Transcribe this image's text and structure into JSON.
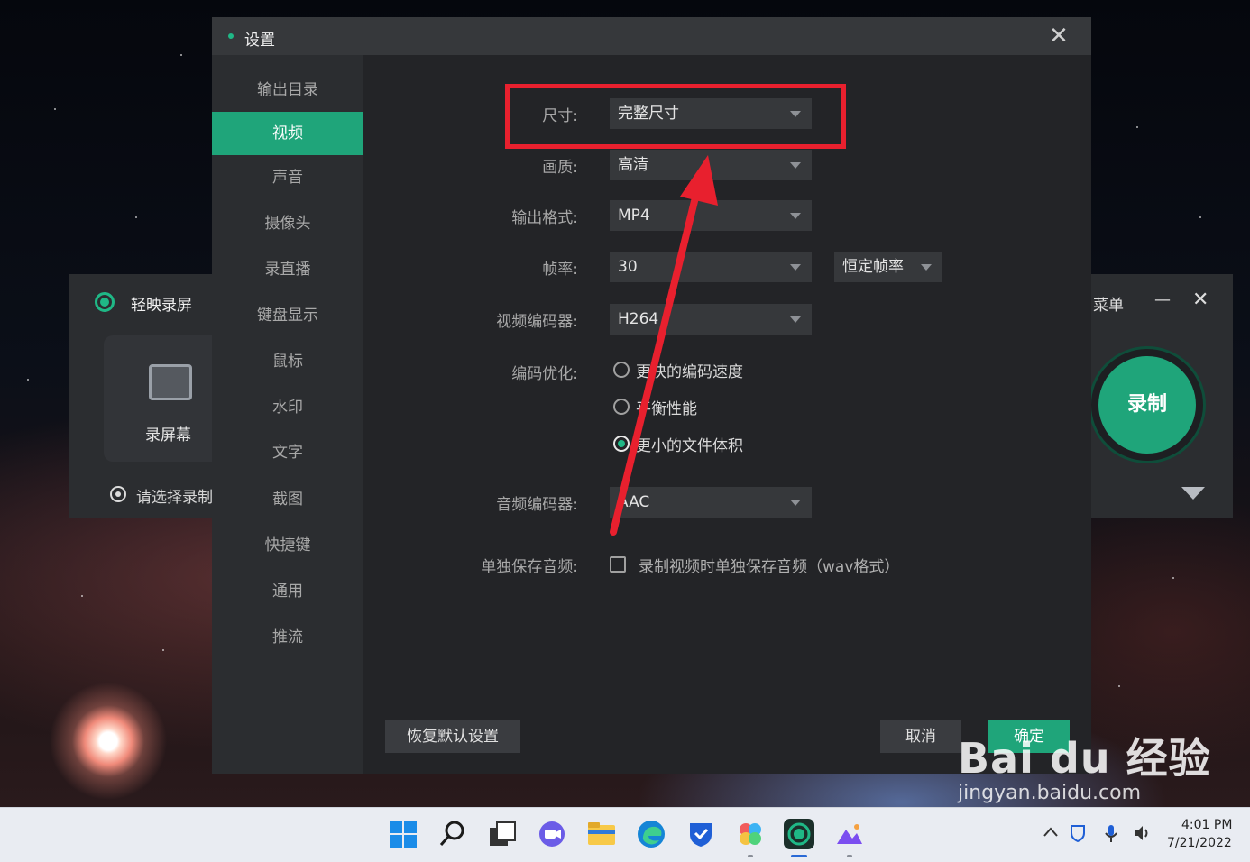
{
  "background_app": {
    "title": "轻映录屏",
    "menu_label": "菜单",
    "min_icon": "—",
    "close_icon": "✕",
    "record_screen_label": "录屏幕",
    "region_placeholder": "请选择录制",
    "record_button_label": "录制"
  },
  "dialog": {
    "title": "设置",
    "close_icon": "✕",
    "sidebar": [
      {
        "label": "输出目录",
        "active": false
      },
      {
        "label": "视频",
        "active": true
      },
      {
        "label": "声音",
        "active": false
      },
      {
        "label": "摄像头",
        "active": false
      },
      {
        "label": "录直播",
        "active": false
      },
      {
        "label": "键盘显示",
        "active": false
      },
      {
        "label": "鼠标",
        "active": false
      },
      {
        "label": "水印",
        "active": false
      },
      {
        "label": "文字",
        "active": false
      },
      {
        "label": "截图",
        "active": false
      },
      {
        "label": "快捷键",
        "active": false
      },
      {
        "label": "通用",
        "active": false
      },
      {
        "label": "推流",
        "active": false
      }
    ],
    "fields": {
      "size": {
        "label": "尺寸:",
        "value": "完整尺寸"
      },
      "quality": {
        "label": "画质:",
        "value": "高清"
      },
      "format": {
        "label": "输出格式:",
        "value": "MP4"
      },
      "framerate": {
        "label": "帧率:",
        "value": "30",
        "mode": "恒定帧率"
      },
      "video_encoder": {
        "label": "视频编码器:",
        "value": "H264"
      },
      "encode_opt": {
        "label": "编码优化:",
        "options": [
          {
            "text": "更快的编码速度",
            "checked": false
          },
          {
            "text": "平衡性能",
            "checked": false
          },
          {
            "text": "更小的文件体积",
            "checked": true
          }
        ]
      },
      "audio_encoder": {
        "label": "音频编码器:",
        "value": "AAC"
      },
      "save_audio": {
        "label": "单独保存音频:",
        "text": "录制视频时单独保存音频（wav格式）",
        "checked": false
      }
    },
    "buttons": {
      "reset": "恢复默认设置",
      "cancel": "取消",
      "ok": "确定"
    }
  },
  "taskbar": {
    "time": "4:01 PM",
    "date": "7/21/2022"
  },
  "watermark": {
    "main": "Bai du 经验",
    "sub": "jingyan.baidu.com"
  },
  "colors": {
    "accent": "#1fa57a",
    "annotation": "#e8202e"
  }
}
